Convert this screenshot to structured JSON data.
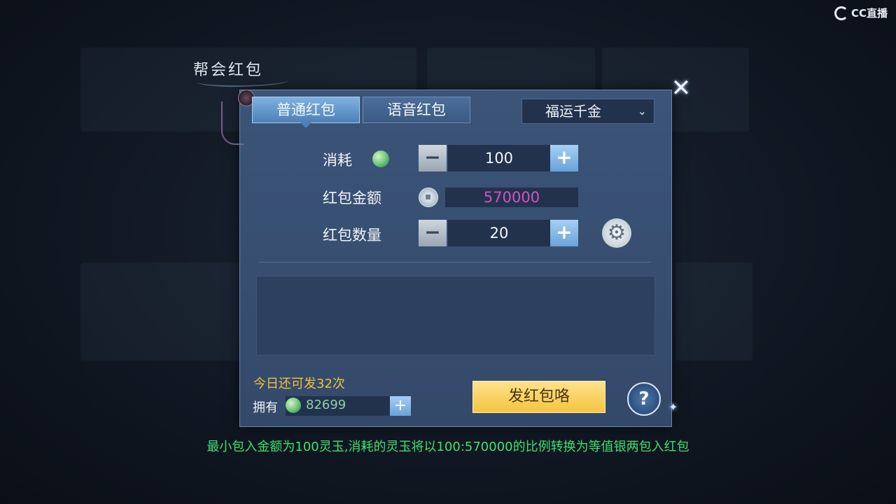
{
  "watermark": {
    "text": "CC直播"
  },
  "dialog": {
    "title": "帮会红包",
    "close_symbol": "✕"
  },
  "tabs": [
    {
      "label": "普通红包",
      "active": true
    },
    {
      "label": "语音红包",
      "active": false
    }
  ],
  "dropdown": {
    "selected": "福运千金",
    "icon": "chevron-down-icon"
  },
  "form": {
    "cost": {
      "label": "消耗",
      "currency_icon": "jade-icon",
      "value": "100"
    },
    "amount": {
      "label": "红包金额",
      "currency_icon": "silver-coin-icon",
      "value": "570000"
    },
    "count": {
      "label": "红包数量",
      "value": "20"
    },
    "minus_symbol": "−",
    "plus_symbol": "+",
    "gear_symbol": "⚙"
  },
  "footer": {
    "remaining_text": "今日还可发32次",
    "own_label": "拥有",
    "own_value": "82699",
    "send_label": "发红包咯",
    "help_symbol": "?"
  },
  "notice": "最小包入金额为100灵玉,消耗的灵玉将以100:570000的比例转换为等值银两包入红包",
  "colors": {
    "panel": "#34496a",
    "amount_text": "#d450c8",
    "remaining_text": "#f0c23a",
    "notice_text": "#3fe070",
    "send_button": "#f4c440"
  }
}
